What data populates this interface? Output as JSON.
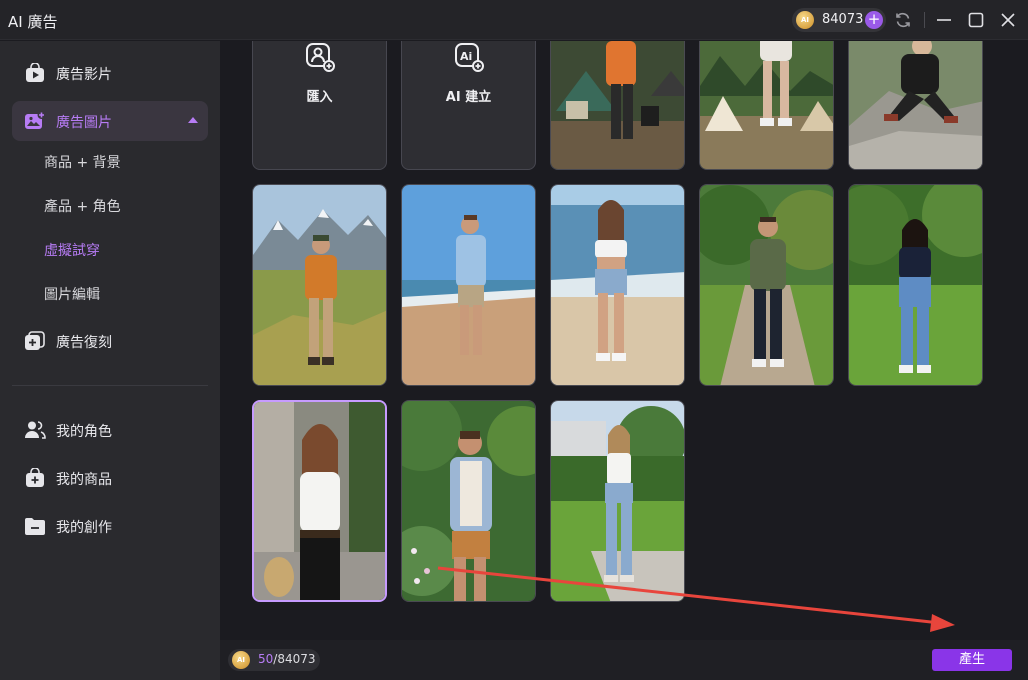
{
  "app": {
    "title": "AI 廣告"
  },
  "credits": {
    "balance": "84073",
    "add_label": "+"
  },
  "sidebar": {
    "items": [
      {
        "label": "廣告影片",
        "icon": "video-bag-icon"
      },
      {
        "label": "廣告圖片",
        "icon": "image-add-icon"
      },
      {
        "label": "廣告復刻",
        "icon": "copy-add-icon"
      },
      {
        "label": "我的角色",
        "icon": "users-icon"
      },
      {
        "label": "我的商品",
        "icon": "bag-add-icon"
      },
      {
        "label": "我的創作",
        "icon": "folder-icon"
      }
    ],
    "sub_items": [
      "商品 + 背景",
      "產品 + 角色",
      "虛擬試穿",
      "圖片編輯"
    ]
  },
  "gallery": {
    "actions": [
      {
        "label": "匯入",
        "icon": "person-add-icon"
      },
      {
        "label": "AI 建立",
        "icon": "ai-add-icon"
      }
    ]
  },
  "bottom": {
    "coin_label": "AI",
    "usage_used": "50",
    "usage_sep": "/84073",
    "generate_label": "產生"
  },
  "colors": {
    "accent": "#8a35e8",
    "accent_text": "#b77cf5",
    "selected_border": "#c79bff",
    "arrow": "#e8453c"
  }
}
